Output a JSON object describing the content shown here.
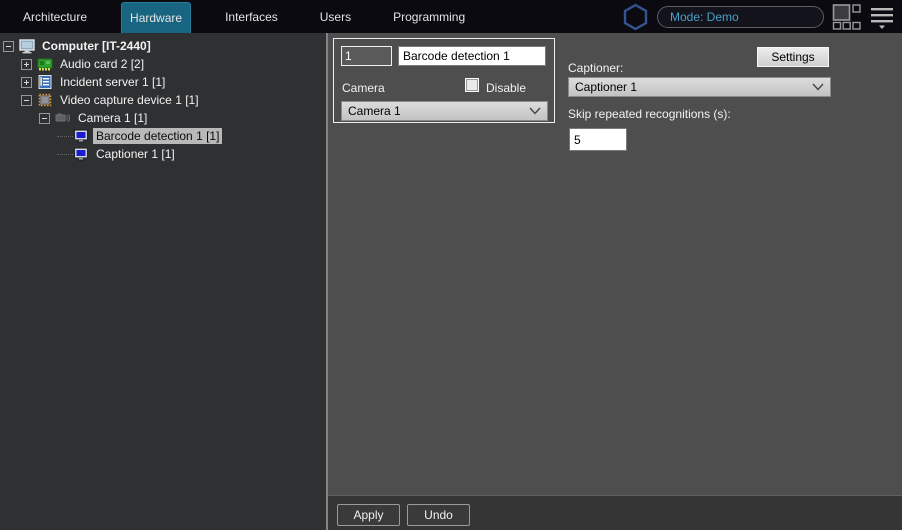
{
  "topbar": {
    "tabs": [
      {
        "label": "Architecture",
        "active": false
      },
      {
        "label": "Hardware",
        "active": true
      },
      {
        "label": "Interfaces",
        "active": false
      },
      {
        "label": "Users",
        "active": false
      },
      {
        "label": "Programming",
        "active": false
      }
    ],
    "mode_field": "Mode: Demo"
  },
  "tree": {
    "items": [
      {
        "label": "Computer [IT-2440]",
        "icon": "computer-icon",
        "expander": "minus",
        "depth": 0,
        "bold": true,
        "selected": false
      },
      {
        "label": "Audio card 2 [2]",
        "icon": "audio-card-icon",
        "expander": "plus",
        "depth": 1,
        "bold": false,
        "selected": false
      },
      {
        "label": "Incident server 1 [1]",
        "icon": "incident-server-icon",
        "expander": "plus",
        "depth": 1,
        "bold": false,
        "selected": false
      },
      {
        "label": "Video capture device 1 [1]",
        "icon": "video-capture-device-icon",
        "expander": "minus",
        "depth": 1,
        "bold": false,
        "selected": false
      },
      {
        "label": "Camera 1 [1]",
        "icon": "camera-icon",
        "expander": "minus",
        "depth": 2,
        "bold": false,
        "selected": false
      },
      {
        "label": "Barcode detection 1 [1]",
        "icon": "monitor-icon",
        "expander": "none",
        "depth": 3,
        "bold": false,
        "selected": true
      },
      {
        "label": "Captioner 1 [1]",
        "icon": "monitor-icon",
        "expander": "none",
        "depth": 3,
        "bold": false,
        "selected": false
      }
    ]
  },
  "panel": {
    "id_value": "1",
    "name_value": "Barcode detection 1",
    "camera_label": "Camera",
    "disable_label": "Disable",
    "camera_selected": "Camera 1",
    "settings_button": "Settings",
    "captioner_label": "Captioner:",
    "captioner_selected": "Captioner 1",
    "skip_label": "Skip repeated recognitions (s):",
    "skip_value": "5"
  },
  "footer": {
    "apply_label": "Apply",
    "undo_label": "Undo"
  },
  "colors": {
    "topbar_bg": "#0a0a10",
    "active_tab": "#186582",
    "mode_text": "#4aa0c8",
    "hexagon_stroke": "#35538e",
    "tree_bg": "#2f3032",
    "main_bg": "#4e4e4f",
    "footer_bg": "#353536",
    "selection_bg": "#b9b9b9",
    "mini_monitor_screen": "#1b1bd0",
    "chip_pins": "#e0922f",
    "audio_card_green": "#2f9e2f",
    "incident_blue": "#3a6fc0"
  }
}
